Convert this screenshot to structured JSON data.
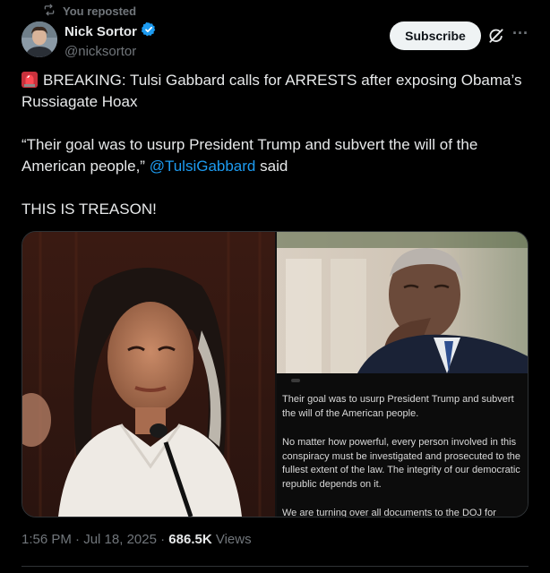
{
  "repost": {
    "icon": "repost-icon",
    "label": "You reposted"
  },
  "author": {
    "name": "Nick Sortor",
    "handle": "@nicksortor",
    "verified": true,
    "verified_color": "#1d9bf0"
  },
  "actions": {
    "subscribe_label": "Subscribe",
    "grok_icon": "grok-icon",
    "more_label": "···"
  },
  "tweet": {
    "siren_icon": "siren-emoji",
    "line1": "BREAKING: Tulsi Gabbard calls for ARRESTS after exposing Obama’s Russiagate Hoax",
    "line2_prefix": "“Their goal was to usurp President Trump and subvert the will of the American people,”",
    "mention": "@TulsiGabbard",
    "line2_suffix": "said",
    "line3": "THIS IS TREASON!"
  },
  "media": {
    "statement": {
      "p1": "Their goal was to usurp President Trump and subvert the will of the American people.",
      "p2": "No matter how powerful, every person involved in this conspiracy must be investigated and prosecuted to the fullest extent of the law. The integrity of our democratic republic depends on it.",
      "p3": "We are turning over all documents to the DOJ for"
    }
  },
  "meta": {
    "time": "1:56 PM",
    "date": "Jul 18, 2025",
    "views_count": "686.5K",
    "views_label": "Views"
  },
  "colors": {
    "background": "#000000",
    "text": "#e7e9ea",
    "muted": "#71767b",
    "link": "#1d9bf0",
    "border": "#2f3336"
  }
}
